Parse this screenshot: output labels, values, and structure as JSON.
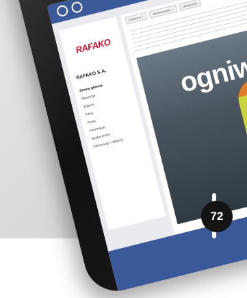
{
  "page": {
    "name": "RAFAKO S.A.",
    "logo_text": "RAFAKO",
    "nav": [
      "Strona główna",
      "Recenzje",
      "Zdjęcia",
      "Filmy",
      "Posty",
      "Informacje",
      "Społeczność",
      "Informacje i reklamy"
    ],
    "tabs": [
      "Polubiono ✓",
      "Obserwowanie ✓",
      "Udostępnij ▾"
    ]
  },
  "poster": {
    "word": "ogniwo"
  },
  "badge": {
    "value": "72"
  }
}
